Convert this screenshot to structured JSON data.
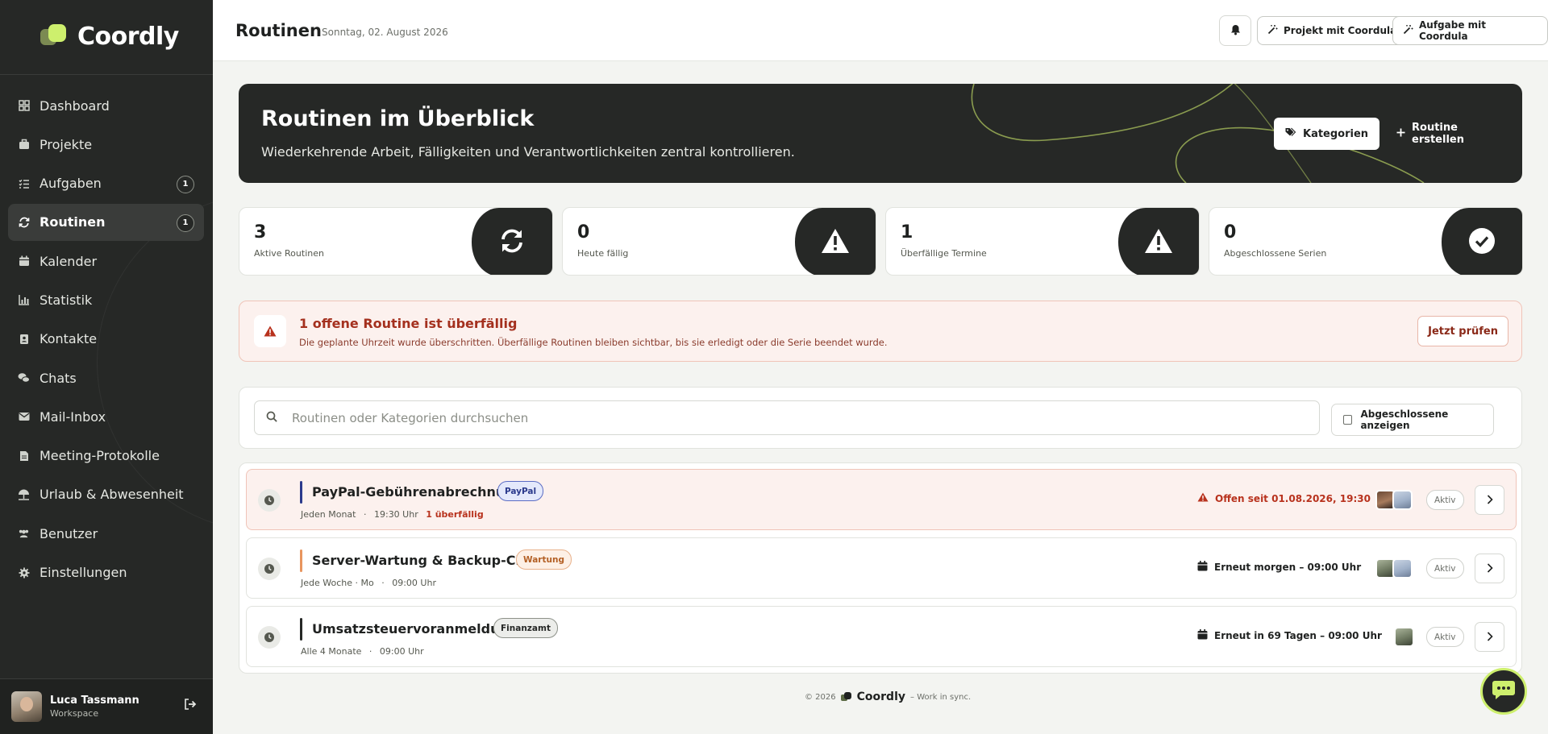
{
  "brand": {
    "name": "Coordly",
    "accent": "#cdef6d",
    "dark": "#262826"
  },
  "sidebar": {
    "items": [
      {
        "label": "Dashboard",
        "icon": "dashboard-icon"
      },
      {
        "label": "Projekte",
        "icon": "briefcase-icon"
      },
      {
        "label": "Aufgaben",
        "icon": "tasks-icon",
        "badge": "1"
      },
      {
        "label": "Routinen",
        "icon": "sync-icon",
        "badge": "1",
        "active": true
      },
      {
        "label": "Kalender",
        "icon": "calendar-icon"
      },
      {
        "label": "Statistik",
        "icon": "chart-icon"
      },
      {
        "label": "Kontakte",
        "icon": "contacts-icon"
      },
      {
        "label": "Chats",
        "icon": "chat-icon"
      },
      {
        "label": "Mail-Inbox",
        "icon": "mail-icon"
      },
      {
        "label": "Meeting-Protokolle",
        "icon": "document-icon"
      },
      {
        "label": "Urlaub & Abwesenheit",
        "icon": "umbrella-icon"
      },
      {
        "label": "Benutzer",
        "icon": "users-icon"
      },
      {
        "label": "Einstellungen",
        "icon": "gear-icon"
      }
    ],
    "user": {
      "name": "Luca Tassmann",
      "role": "Workspace"
    }
  },
  "header": {
    "title": "Routinen",
    "date": "Sonntag, 02. August 2026",
    "project_button": "Projekt mit Coordula",
    "task_button": "Aufgabe mit Coordula"
  },
  "hero": {
    "title": "Routinen im Überblick",
    "subtitle": "Wiederkehrende Arbeit, Fälligkeiten und Verantwortlichkeiten zentral kontrollieren.",
    "categories_button": "Kategorien",
    "create_button": "Routine erstellen"
  },
  "stats": [
    {
      "value": "3",
      "label": "Aktive Routinen",
      "icon": "sync-icon"
    },
    {
      "value": "0",
      "label": "Heute fällig",
      "icon": "warning-icon"
    },
    {
      "value": "1",
      "label": "Überfällige Termine",
      "icon": "warning-icon"
    },
    {
      "value": "0",
      "label": "Abgeschlossene Serien",
      "icon": "check-circle-icon"
    }
  ],
  "alert": {
    "title": "1 offene Routine ist überfällig",
    "text": "Die geplante Uhrzeit wurde überschritten. Überfällige Routinen bleiben sichtbar, bis sie erledigt oder die Serie beendet wurde.",
    "button": "Jetzt prüfen"
  },
  "search": {
    "placeholder": "Routinen oder Kategorien durchsuchen",
    "value": "",
    "checkbox_label": "Abgeschlossene anzeigen",
    "checked": false
  },
  "routines": [
    {
      "title": "PayPal-Gebührenabrechnung",
      "tag": "PayPal",
      "interval": "Jeden Monat",
      "time": "19:30 Uhr",
      "overdue": "1 überfällig",
      "due": "Offen seit 01.08.2026, 19:30",
      "status": "Aktiv",
      "bar_color": "#2b3a8c"
    },
    {
      "title": "Server-Wartung & Backup-Cloud",
      "tag": "Wartung",
      "interval": "Jede Woche · Mo",
      "time": "09:00 Uhr",
      "overdue": "",
      "due": "Erneut morgen – 09:00 Uhr",
      "status": "Aktiv",
      "bar_color": "#e8955e"
    },
    {
      "title": "Umsatzsteuervoranmeldung",
      "tag": "Finanzamt",
      "interval": "Alle 4 Monate",
      "time": "09:00 Uhr",
      "overdue": "",
      "due": "Erneut in 69 Tagen – 09:00 Uhr",
      "status": "Aktiv",
      "bar_color": "#262826"
    }
  ],
  "footer": {
    "copyright": "© 2026",
    "brand": "Coordly",
    "tagline": "– Work in sync."
  },
  "meta_sep": "·"
}
